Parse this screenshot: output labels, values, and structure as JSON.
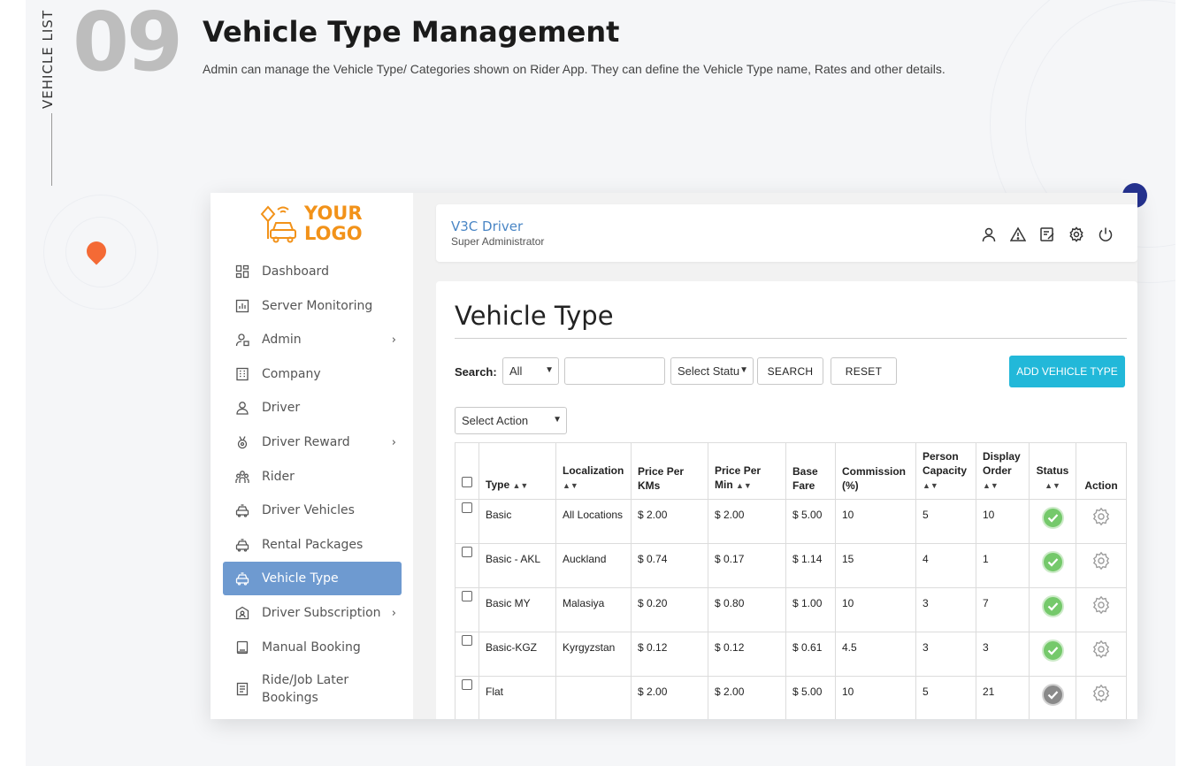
{
  "hero": {
    "side_label": "VEHICLE LIST",
    "number": "09",
    "title": "Vehicle Type Management",
    "description": "Admin can manage the Vehicle Type/ Categories shown on Rider App. They can define the Vehicle Type name, Rates and other details."
  },
  "logo": {
    "line1": "YOUR",
    "line2": "LOGO"
  },
  "sidebar": {
    "items": [
      {
        "label": "Dashboard",
        "icon": "dashboard-icon",
        "chevron": false
      },
      {
        "label": "Server Monitoring",
        "icon": "chart-icon",
        "chevron": false
      },
      {
        "label": "Admin",
        "icon": "admin-user-icon",
        "chevron": true
      },
      {
        "label": "Company",
        "icon": "building-icon",
        "chevron": false
      },
      {
        "label": "Driver",
        "icon": "driver-icon",
        "chevron": false
      },
      {
        "label": "Driver Reward",
        "icon": "medal-icon",
        "chevron": true
      },
      {
        "label": "Rider",
        "icon": "group-icon",
        "chevron": false
      },
      {
        "label": "Driver Vehicles",
        "icon": "taxi-icon",
        "chevron": false
      },
      {
        "label": "Rental Packages",
        "icon": "taxi-icon",
        "chevron": false
      },
      {
        "label": "Vehicle Type",
        "icon": "taxi-icon",
        "chevron": false,
        "active": true
      },
      {
        "label": "Driver Subscription",
        "icon": "subscription-icon",
        "chevron": true
      },
      {
        "label": "Manual Booking",
        "icon": "book-icon",
        "chevron": false
      },
      {
        "label": "Ride/Job Later Bookings",
        "icon": "list-icon",
        "chevron": false
      }
    ]
  },
  "topbar": {
    "name": "V3C Driver",
    "role": "Super Administrator",
    "icons": [
      "profile-icon",
      "alert-icon",
      "edit-icon",
      "settings-icon",
      "power-icon"
    ]
  },
  "panel": {
    "title": "Vehicle Type",
    "search_label": "Search:",
    "search_select": "All",
    "search_input": "",
    "status_select": "Select Statu",
    "search_button": "SEARCH",
    "reset_button": "RESET",
    "add_button": "ADD VEHICLE TYPE",
    "action_select": "Select Action"
  },
  "table": {
    "headers": [
      "Type",
      "Localization",
      "Price Per KMs",
      "Price Per Min",
      "Base Fare",
      "Commission (%)",
      "Person Capacity",
      "Display Order",
      "Status",
      "Action"
    ],
    "rows": [
      {
        "type": "Basic",
        "localization": "All Locations",
        "price_km": "$ 2.00",
        "price_min": "$ 2.00",
        "base_fare": "$ 5.00",
        "commission": "10",
        "capacity": "5",
        "order": "10",
        "status": "active"
      },
      {
        "type": "Basic - AKL",
        "localization": "Auckland",
        "price_km": "$ 0.74",
        "price_min": "$ 0.17",
        "base_fare": "$ 1.14",
        "commission": "15",
        "capacity": "4",
        "order": "1",
        "status": "active"
      },
      {
        "type": "Basic MY",
        "localization": "Malasiya",
        "price_km": "$ 0.20",
        "price_min": "$ 0.80",
        "base_fare": "$ 1.00",
        "commission": "10",
        "capacity": "3",
        "order": "7",
        "status": "active"
      },
      {
        "type": "Basic-KGZ",
        "localization": "Kyrgyzstan",
        "price_km": "$ 0.12",
        "price_min": "$ 0.12",
        "base_fare": "$ 0.61",
        "commission": "4.5",
        "capacity": "3",
        "order": "3",
        "status": "active"
      },
      {
        "type": "Flat",
        "localization": "",
        "price_km": "$ 2.00",
        "price_min": "$ 2.00",
        "base_fare": "$ 5.00",
        "commission": "10",
        "capacity": "5",
        "order": "21",
        "status": "inactive"
      }
    ]
  },
  "colors": {
    "accent": "#22b8d9",
    "active_nav": "#6e9ad0",
    "logo": "#f29219",
    "status_active": "#75c96b",
    "status_inactive": "#8a8a8a"
  }
}
